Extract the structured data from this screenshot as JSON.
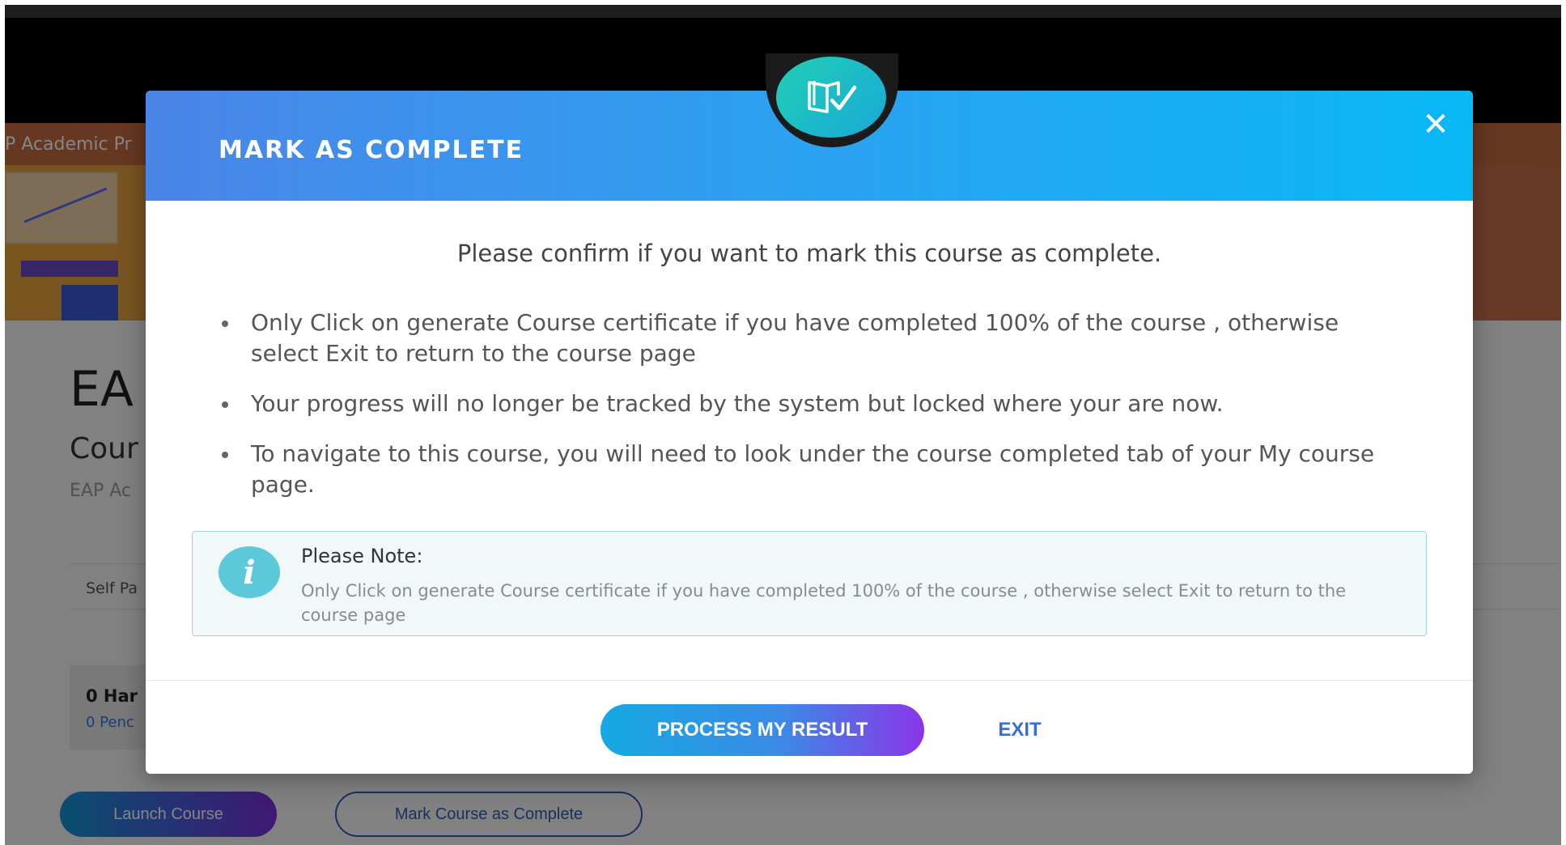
{
  "background": {
    "banner_title": "P Academic Pr",
    "course_title": "EA",
    "course_subtitle": "Cour",
    "course_org": "EAP Ac",
    "self_paced": "Self Pa",
    "stat_main": "0 Har",
    "stat_sub": "0 Penc",
    "launch_button": "Launch Course",
    "mark_complete_button": "Mark Course as Complete"
  },
  "modal": {
    "title": "MARK AS COMPLETE",
    "close_glyph": "✕",
    "badge_icon": "book-check-icon",
    "confirm_text": "Please confirm if you want to mark this course as complete.",
    "bullets": [
      "Only Click on generate Course certificate if you have completed 100% of the course , otherwise select Exit to return to the course page",
      "Your progress will no longer be tracked by the system but locked where your are now.",
      "To navigate to this course, you will need to look under the course completed tab of your My course page."
    ],
    "note": {
      "icon_glyph": "i",
      "title": "Please Note:",
      "text": "Only Click on generate Course certificate if you have completed 100% of the course , otherwise select Exit to return to the course page"
    },
    "buttons": {
      "process": "PROCESS MY RESULT",
      "exit": "EXIT"
    }
  },
  "colors": {
    "header_gradient_start": "#4a85e8",
    "header_gradient_end": "#08b8f5",
    "process_gradient_start": "#14a9e2",
    "process_gradient_end": "#8a35e8",
    "exit_color": "#3a6ed6",
    "note_border": "#9fd6e4",
    "note_icon": "#5cc9da"
  }
}
